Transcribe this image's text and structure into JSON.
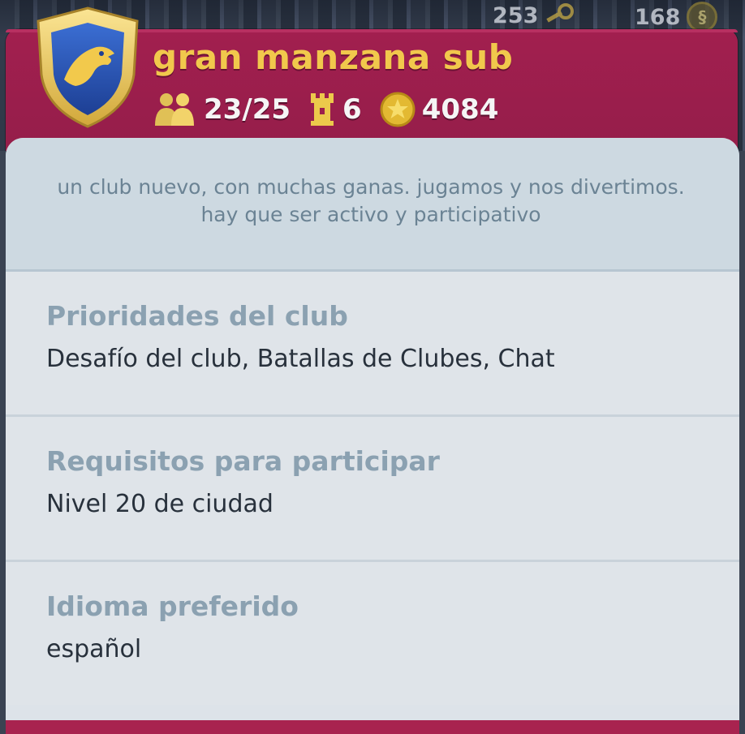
{
  "topbar": {
    "counter_1": "253",
    "counter_2": "168",
    "counter_1_icon": "key-icon",
    "counter_2_icon": "simoleon-coin-icon",
    "coin_symbol": "§"
  },
  "club": {
    "name": "gran manzana sub",
    "emblem_icon": "eagle-shield-icon",
    "members": "23/25",
    "level": "6",
    "points": "4084",
    "members_icon": "members-icon",
    "level_icon": "tower-icon",
    "points_icon": "gold-coin-icon",
    "description": "un club nuevo, con muchas ganas. jugamos y nos divertimos. hay que ser activo y participativo"
  },
  "sections": [
    {
      "title": "Prioridades del club",
      "value": "Desafío del club, Batallas de Clubes, Chat"
    },
    {
      "title": "Requisitos para participar",
      "value": "Nivel 20 de ciudad"
    },
    {
      "title": "Idioma preferido",
      "value": "español"
    }
  ],
  "colors": {
    "header": "#9c1f4c",
    "club_name": "#f1c84c",
    "card": "#dde3e9",
    "section_title": "#8ba1b1",
    "section_value": "#28313c",
    "description": "#6b8394"
  }
}
